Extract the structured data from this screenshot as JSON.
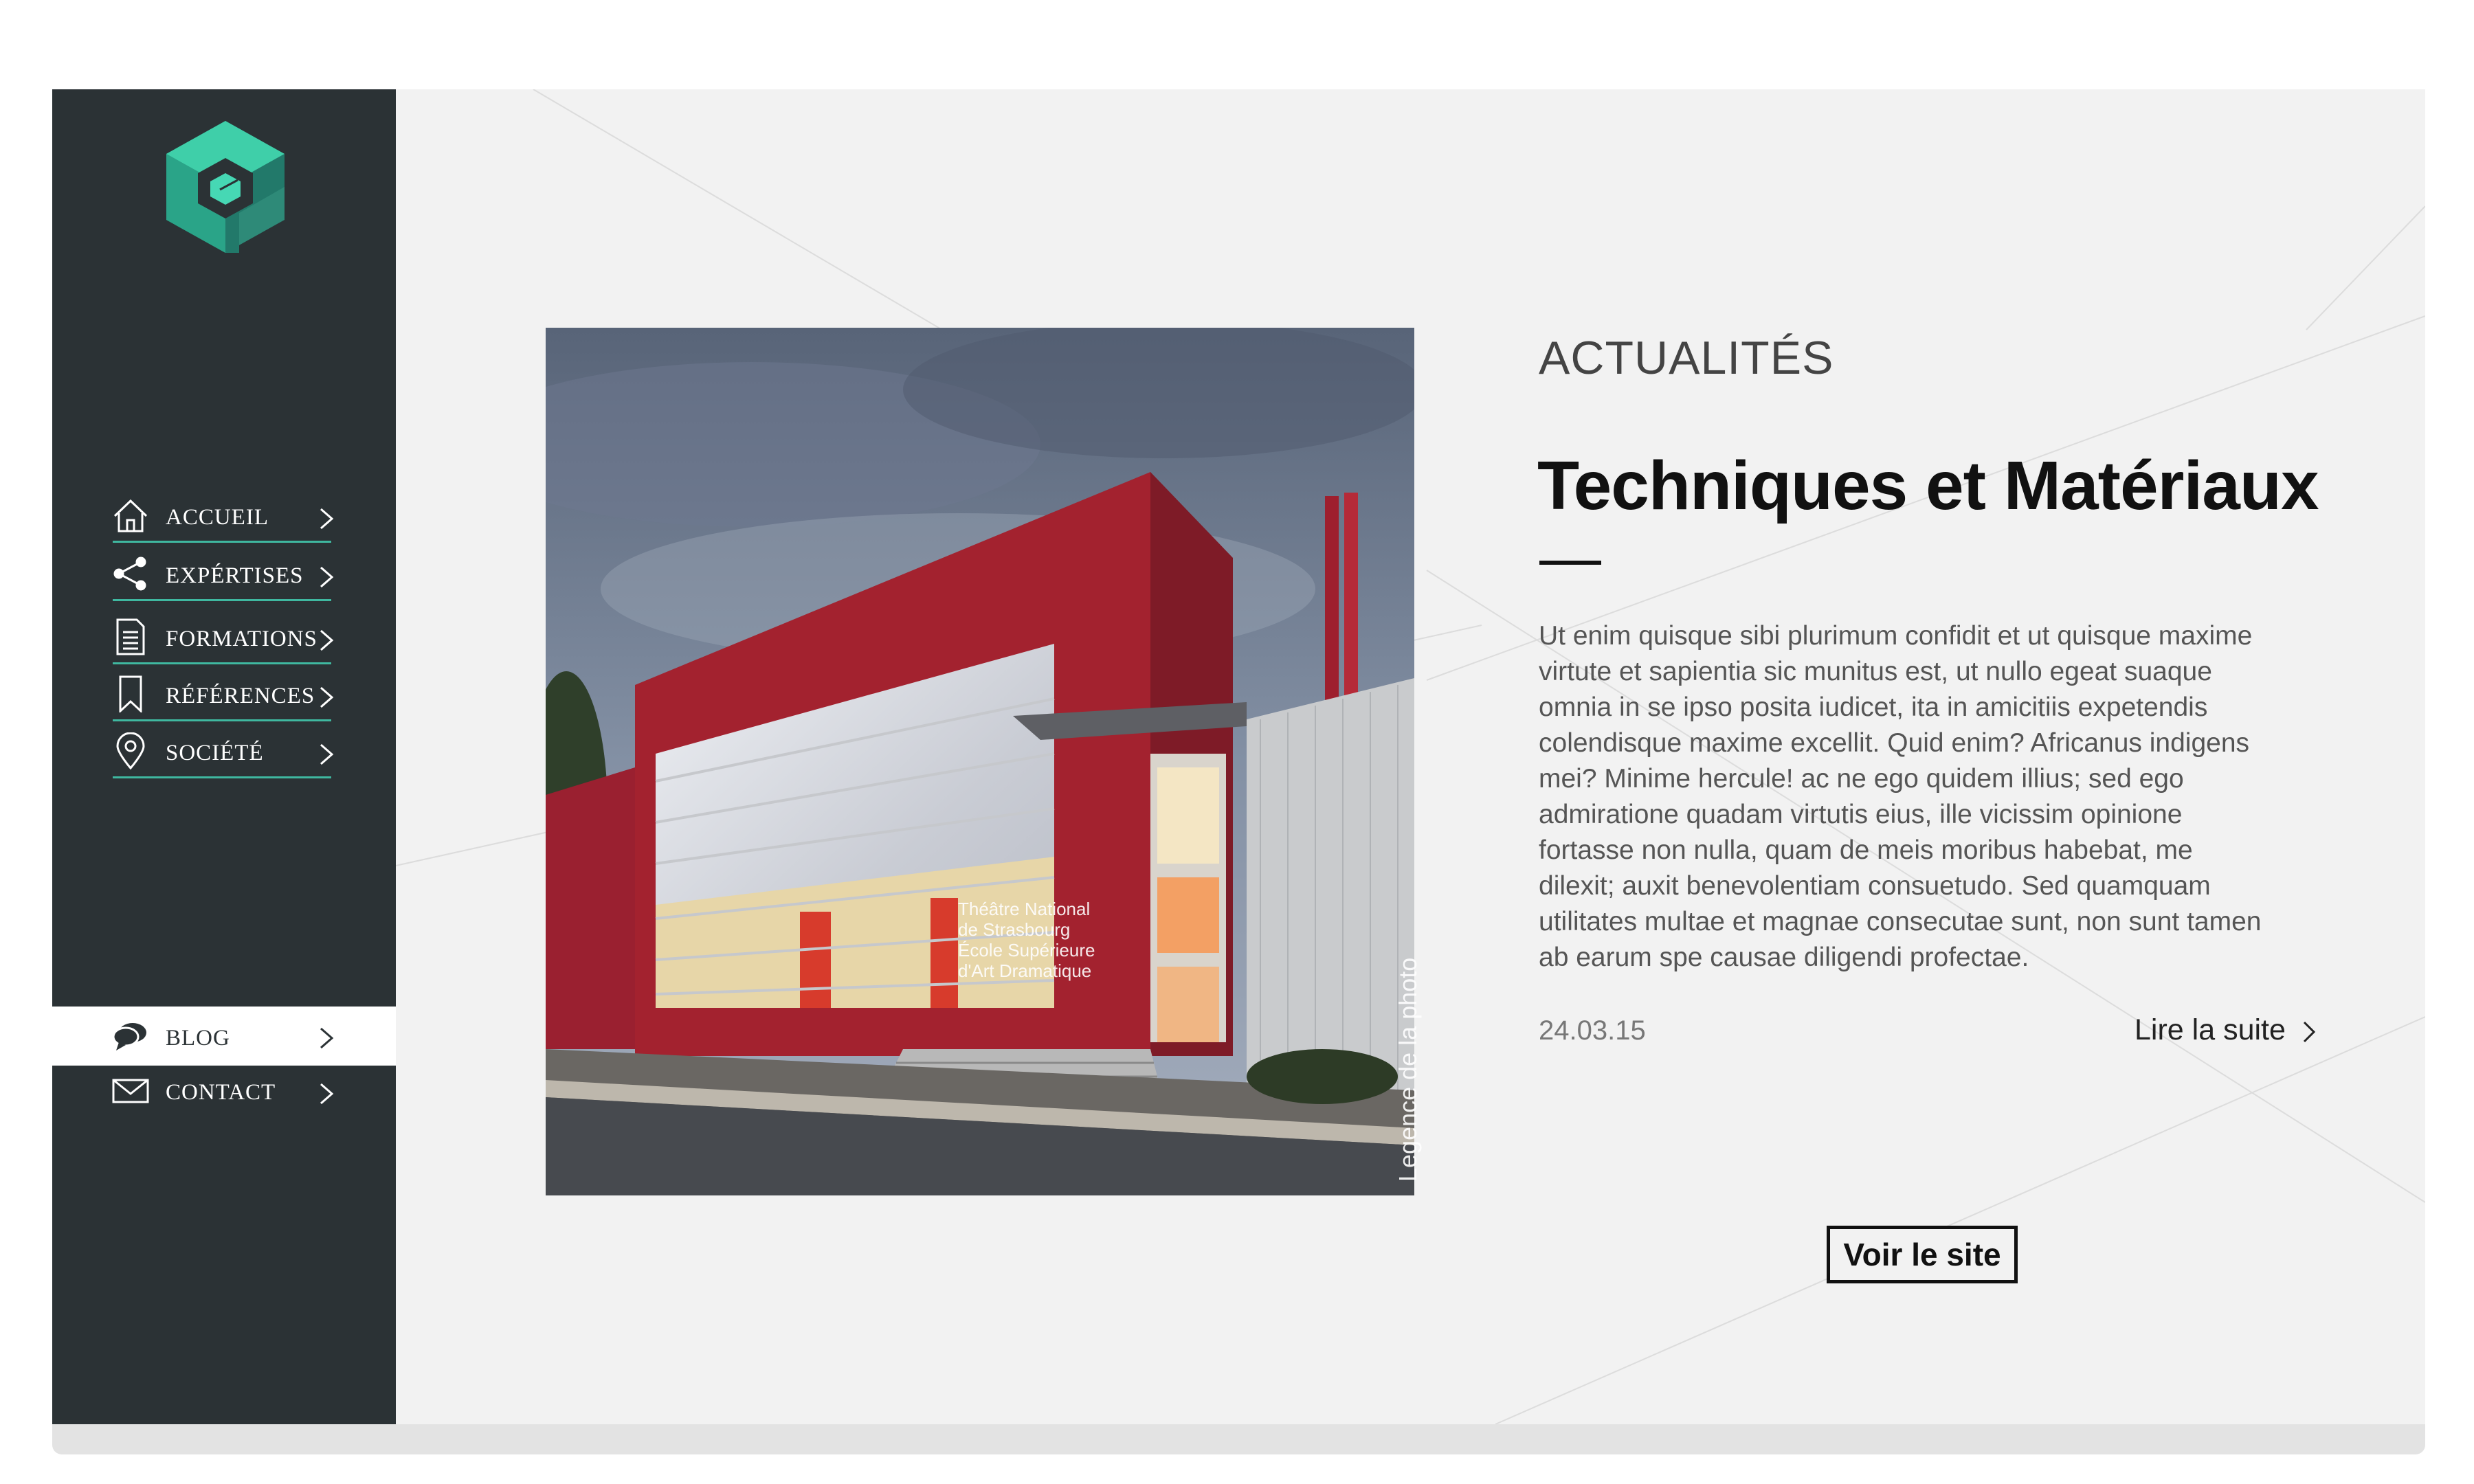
{
  "nav": {
    "items": [
      {
        "label": "ACCUEIL",
        "icon": "home-icon"
      },
      {
        "label": "EXPÉRTISES",
        "icon": "share-icon"
      },
      {
        "label": "FORMATIONS",
        "icon": "document-icon"
      },
      {
        "label": "RÉFÉRENCES",
        "icon": "bookmark-icon"
      },
      {
        "label": "SOCIÉTÉ",
        "icon": "location-pin-icon"
      },
      {
        "label": "BLOG",
        "icon": "chat-bubbles-icon",
        "active": true
      },
      {
        "label": "CONTACT",
        "icon": "envelope-icon"
      }
    ]
  },
  "photo": {
    "caption": "Legence de la photo",
    "signage": [
      "Théâtre National",
      "de Strasbourg",
      "École Supérieure",
      "d'Art Dramatique"
    ]
  },
  "article": {
    "section": "ACTUALITÉS",
    "title": "Techniques et Matériaux",
    "body": "Ut enim quisque sibi plurimum confidit et ut quisque maxime virtute et sapientia sic munitus est, ut nullo egeat suaque omnia in se ipso posita iudicet, ita in amicitiis expetendis colendisque maxime excellit. Quid enim? Africanus indigens mei? Minime hercule! ac ne ego quidem illius; sed ego admiratione quadam virtutis eius, ille vicissim opinione fortasse non nulla, quam de meis moribus habebat, me dilexit; auxit benevolentiam consuetudo. Sed quamquam utilitates multae et magnae consecutae sunt, non sunt tamen ab earum spe causae diligendi profectae.",
    "date": "24.03.15",
    "read_more": "Lire la suite",
    "site_button": "Voir le site"
  },
  "colors": {
    "sidebar": "#2b3235",
    "accent": "#3fb8a0",
    "background": "#f2f2f2"
  }
}
